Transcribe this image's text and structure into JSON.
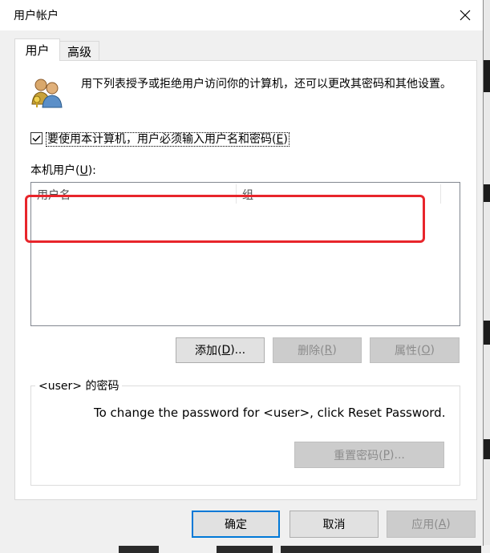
{
  "dialog": {
    "title": "用户帐户",
    "tabs": [
      "用户",
      "高级"
    ],
    "description": "用下列表授予或拒绝用户访问你的计算机，还可以更改其密码和其他设置。",
    "require_login": {
      "checked": true,
      "label_before": "要使用本计算机，用户必须输入用户名和密码(",
      "access_key": "E",
      "label_after": ")"
    },
    "local_users": {
      "label_before": "本机用户(",
      "access_key": "U",
      "label_after": "):",
      "columns": [
        "用户名",
        "组"
      ],
      "rows": []
    },
    "buttons": {
      "add": {
        "before": "添加(",
        "key": "D",
        "after": ")..."
      },
      "remove": {
        "before": "删除(",
        "key": "R",
        "after": ")"
      },
      "properties": {
        "before": "属性(",
        "key": "O",
        "after": ")"
      }
    },
    "password_group": {
      "title": "<user> 的密码",
      "instruction": "To change the password for <user>, click Reset Password.",
      "reset_button": {
        "before": "重置密码(",
        "key": "P",
        "after": ")..."
      }
    },
    "footer": {
      "ok": "确定",
      "cancel": "取消",
      "apply": {
        "before": "应用(",
        "key": "A",
        "after": ")"
      }
    }
  },
  "colors": {
    "highlight_annotation": "#e8252b",
    "default_button_border": "#0078d7"
  },
  "icons": [
    "close-icon",
    "users-icon",
    "checkmark-icon"
  ]
}
